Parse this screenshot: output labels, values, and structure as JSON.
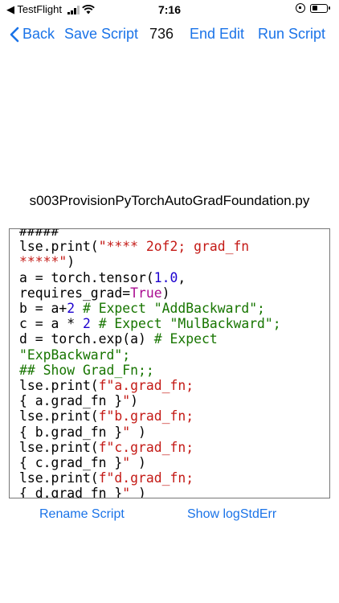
{
  "status_bar": {
    "carrier": "◀ TestFlight",
    "time": "7:16",
    "battery_level": 0.35
  },
  "nav": {
    "back_label": "Back",
    "save_label": "Save Script",
    "count": "736",
    "end_edit_label": "End Edit",
    "run_label": "Run Script"
  },
  "filename": "s003ProvisionPyTorchAutoGradFoundation.py",
  "code": {
    "line0": "#####",
    "line1a": "lse.print(",
    "line1b": "\"**** 2of2; grad_fn",
    "line2a": "*****\"",
    "line2b": ")",
    "line3a": "a = torch.tensor(",
    "line3b": "1.0",
    "line3c": ",",
    "line4a": "requires_grad=",
    "line4b": "True",
    "line4c": ")",
    "line5a": "b = a+",
    "line5b": "2",
    "line5c": " # Expect \"AddBackward\";",
    "line6a": "c = a * ",
    "line6b": "2",
    "line6c": " # Expect \"MulBackward\";",
    "line7a": "d = torch.exp(a) ",
    "line7b": "# Expect",
    "line8": "\"ExpBackward\";",
    "line9": "## Show Grad_Fn;;",
    "line10a": "lse.print(",
    "line10b": "f\"a.grad_fn;",
    "line11a": "{ a.grad_fn }",
    "line11b": "\"",
    "line11c": ")",
    "line12a": "lse.print(",
    "line12b": "f\"b.grad_fn;",
    "line13a": "{ b.grad_fn }",
    "line13b": "\"",
    "line13c": " )",
    "line14a": "lse.print(",
    "line14b": "f\"c.grad_fn;",
    "line15a": "{ c.grad_fn }",
    "line15b": "\"",
    "line15c": " )",
    "line16a": "lse.print(",
    "line16b": "f\"d.grad_fn;",
    "line17a": "{ d.grad_fn }",
    "line17b": "\"",
    "line17c": " )",
    "line18": "####"
  },
  "bottom": {
    "rename_label": "Rename Script",
    "logerr_label": "Show logStdErr"
  },
  "colors": {
    "accent": "#1a73e8",
    "string": "#c41a16",
    "number": "#1c00cf",
    "keyword": "#aa0d91",
    "comment": "#177500"
  }
}
